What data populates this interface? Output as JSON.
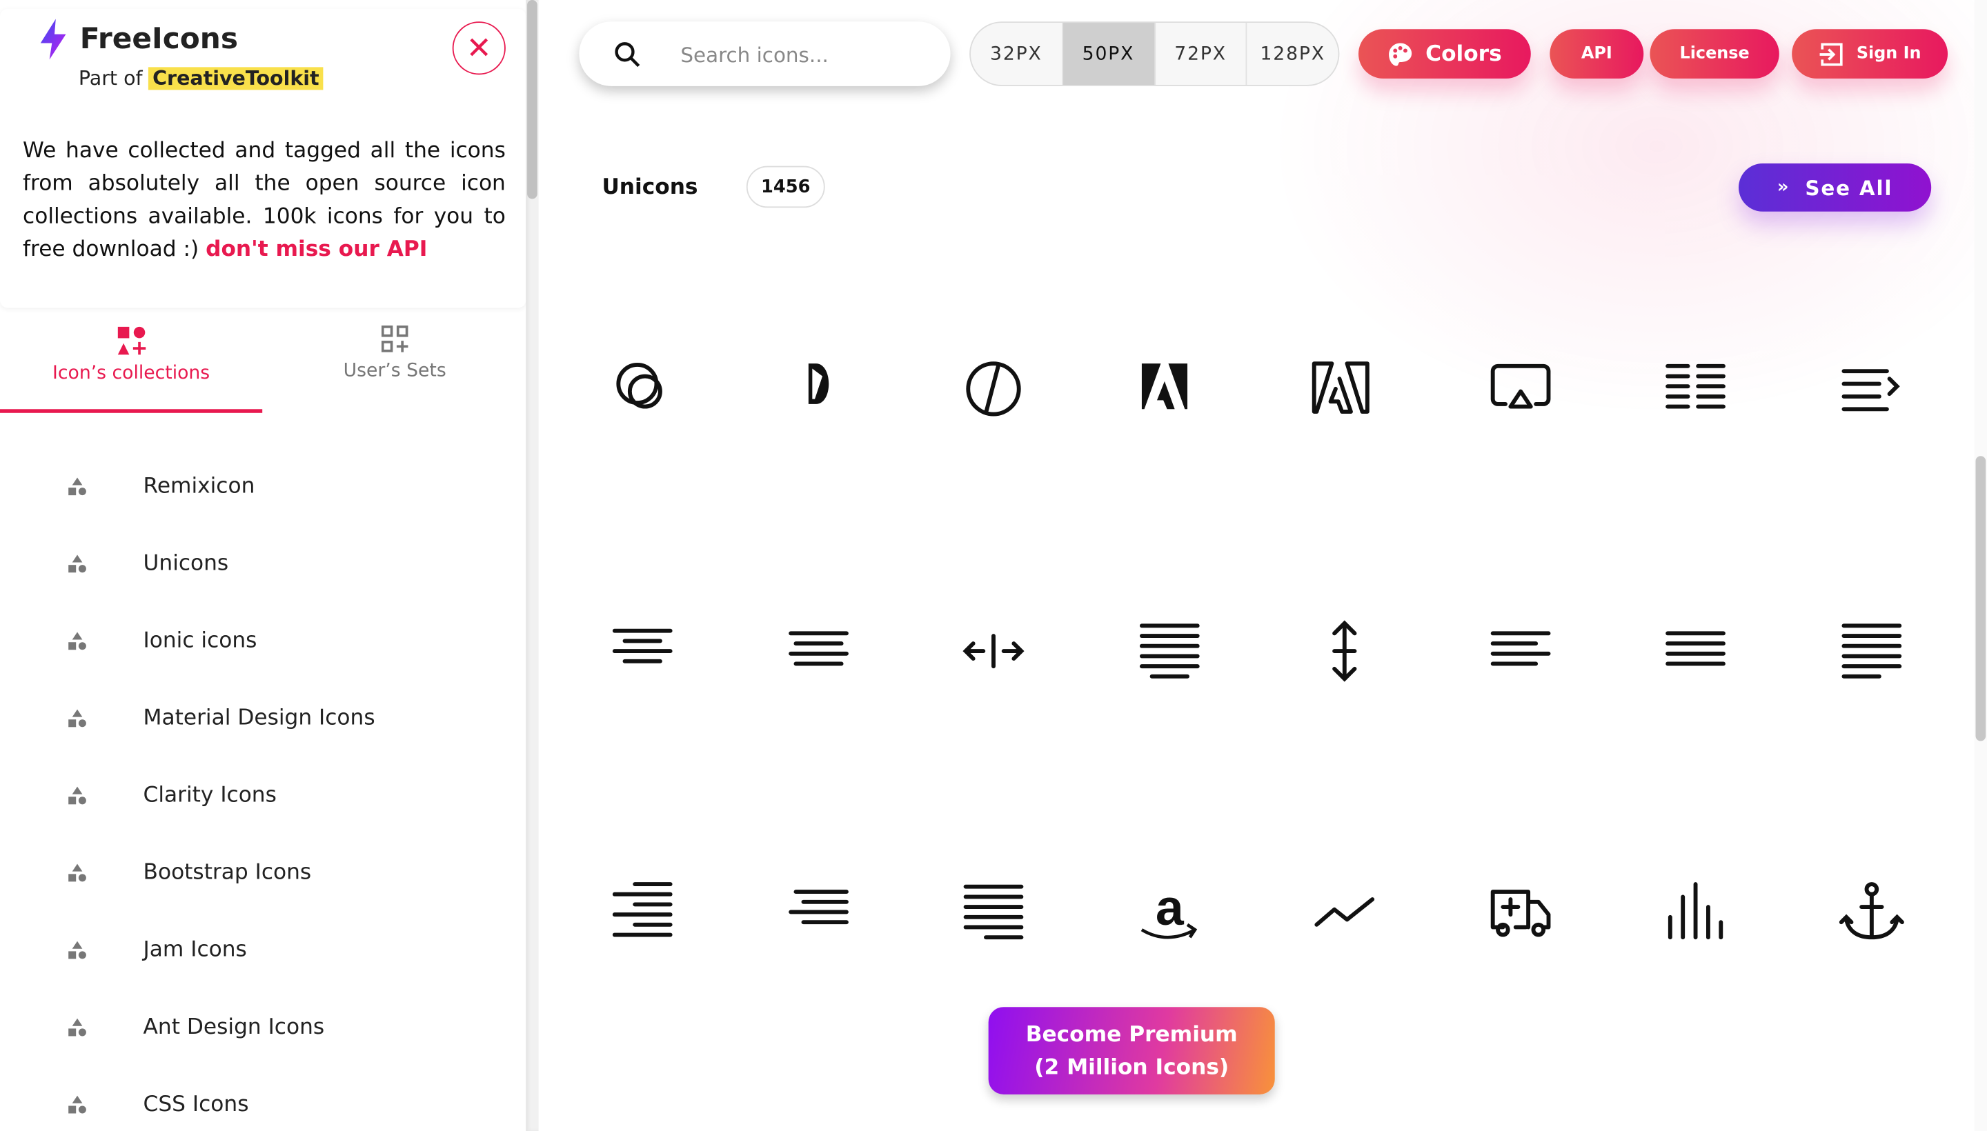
{
  "sidebar": {
    "brand": "FreeIcons",
    "part_of": "Part of",
    "part_of_link": "CreativeToolkit",
    "description": "We have collected and tagged all the icons from absolutely all the open source icon collections available. 100k icons for you to free download :)",
    "api_link": "don't miss our API",
    "tabs": [
      {
        "label": "Icon’s collections",
        "active": true
      },
      {
        "label": "User’s Sets",
        "active": false
      }
    ],
    "collections": [
      "Remixicon",
      "Unicons",
      "Ionic icons",
      "Material Design Icons",
      "Clarity Icons",
      "Bootstrap Icons",
      "Jam Icons",
      "Ant Design Icons",
      "CSS Icons"
    ]
  },
  "header": {
    "search_placeholder": "Search icons...",
    "sizes": [
      {
        "label": "32PX",
        "selected": false
      },
      {
        "label": "50PX",
        "selected": true
      },
      {
        "label": "72PX",
        "selected": false
      },
      {
        "label": "128PX",
        "selected": false
      }
    ],
    "colors_label": "Colors",
    "api_label": "API",
    "license_label": "License",
    "signin_label": "Sign In"
  },
  "section": {
    "title": "Unicons",
    "count": "1456",
    "see_all": "See All",
    "icons": [
      "circle-layer-icon",
      "adobe-alt-icon",
      "adobe-circle-icon",
      "adobe-icon",
      "adobe-outline-icon",
      "airplay-icon",
      "align-alt-icon",
      "align-center-justify-icon",
      "align-center-icon",
      "align-center-alt-icon",
      "arrows-h-alt-icon",
      "align-justify-icon",
      "arrows-v-alt-icon",
      "align-left-icon",
      "align-left-justify-icon",
      "align-letter-icon",
      "align-right-icon",
      "align-right-alt-icon",
      "align-right-justify-icon",
      "amazon-icon",
      "analysis-icon",
      "ambulance-icon",
      "analytics-icon",
      "anchor-icon"
    ]
  },
  "premium": {
    "line1": "Become Premium",
    "line2": "(2 Million Icons)"
  },
  "colors": {
    "accent": "#e8194f",
    "purple": "#6a23d6",
    "highlight": "#f9e04b"
  }
}
